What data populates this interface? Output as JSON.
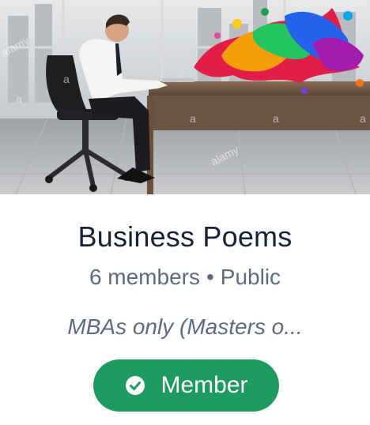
{
  "group": {
    "name": "Business Poems",
    "member_count": "6 members",
    "separator": "•",
    "visibility": "Public",
    "description": "MBAs only (Masters o...",
    "cover_image_watermark": "alamy"
  },
  "membership_button": {
    "label": "Member",
    "icon": "check-circle-icon"
  },
  "colors": {
    "title": "#16213a",
    "meta": "#5d6b82",
    "button_bg": "#1e9a5f",
    "button_text": "#ffffff"
  }
}
